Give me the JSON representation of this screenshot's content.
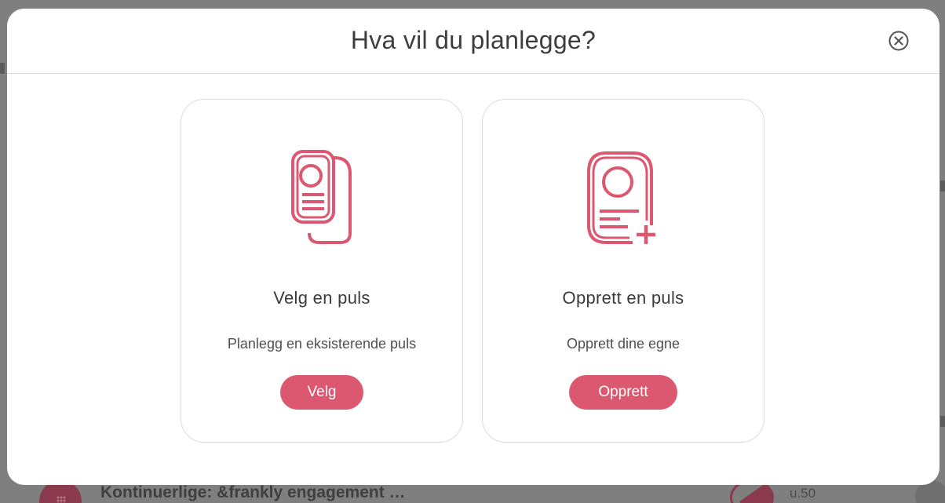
{
  "background": {
    "row_title": "Kontinuerlige: &frankly engagement …",
    "row_week": "u.50"
  },
  "modal": {
    "title": "Hva vil du planlegge?",
    "close_icon": "close-circle-icon",
    "options": [
      {
        "icon": "documents-copy-icon",
        "title": "Velg en puls",
        "description": "Planlegg en eksisterende puls",
        "button": "Velg"
      },
      {
        "icon": "document-add-icon",
        "title": "Opprett en puls",
        "description": "Opprett dine egne",
        "button": "Opprett"
      }
    ]
  },
  "colors": {
    "accent": "#dc5770",
    "overlay": "#7f7f7f",
    "text": "#3d3d3d",
    "border": "#dcdcdc"
  }
}
